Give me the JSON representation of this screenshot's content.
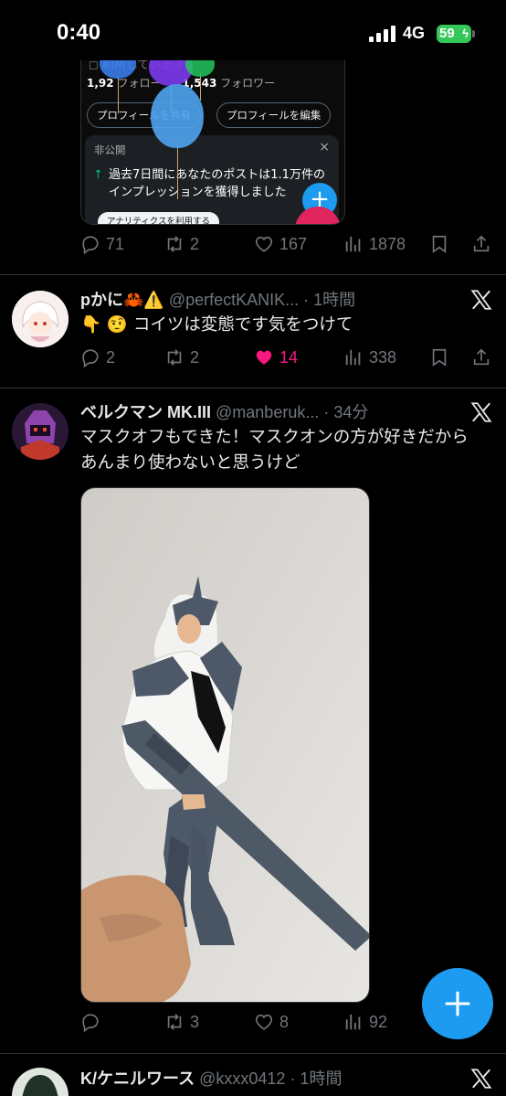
{
  "status_bar": {
    "time": "0:40",
    "network": "4G",
    "battery": "59"
  },
  "embedded_card": {
    "faded_text": "利用しています",
    "following_count": "1,92",
    "following_label": "フォロー",
    "followers_count": "1,543",
    "followers_label": "フォロワー",
    "share_profile": "プロフィールを共有",
    "edit_profile": "プロフィールを編集",
    "private_label": "非公開",
    "close": "×",
    "impression_text": "過去7日間にあなたのポストは1.1万件のインプレッションを獲得しました",
    "analytics_button": "アナリティクスを利用する",
    "plus": "+"
  },
  "tweets": [
    {
      "actions": {
        "replies": "71",
        "retweets": "2",
        "likes": "167",
        "views": "1878"
      }
    },
    {
      "name": "pかに🦀⚠️",
      "handle_time": "@perfectKANIK... · 1時間",
      "text": "👇 🤨 コイツは変態です気をつけて",
      "actions": {
        "replies": "2",
        "retweets": "2",
        "likes": "14",
        "views": "338"
      }
    },
    {
      "name": "ベルクマン MK.III",
      "handle_time": "@manberuk... · 34分",
      "text": "マスクオフもできた！マスクオンの方が好きだからあんまり使わないと思うけど",
      "actions": {
        "replies": "",
        "retweets": "3",
        "likes": "8",
        "views": "92"
      }
    },
    {
      "name": "K/ケニルワース",
      "handle_time": "@kxxx0412 · 1時間"
    }
  ],
  "colors": {
    "accent": "#1d9bf0",
    "like_active": "#f91880",
    "muted": "#71767b",
    "battery": "#34c759"
  },
  "icons": [
    "reply-icon",
    "retweet-icon",
    "like-icon",
    "views-icon",
    "bookmark-icon",
    "share-icon",
    "x-logo-icon",
    "plus-icon"
  ]
}
